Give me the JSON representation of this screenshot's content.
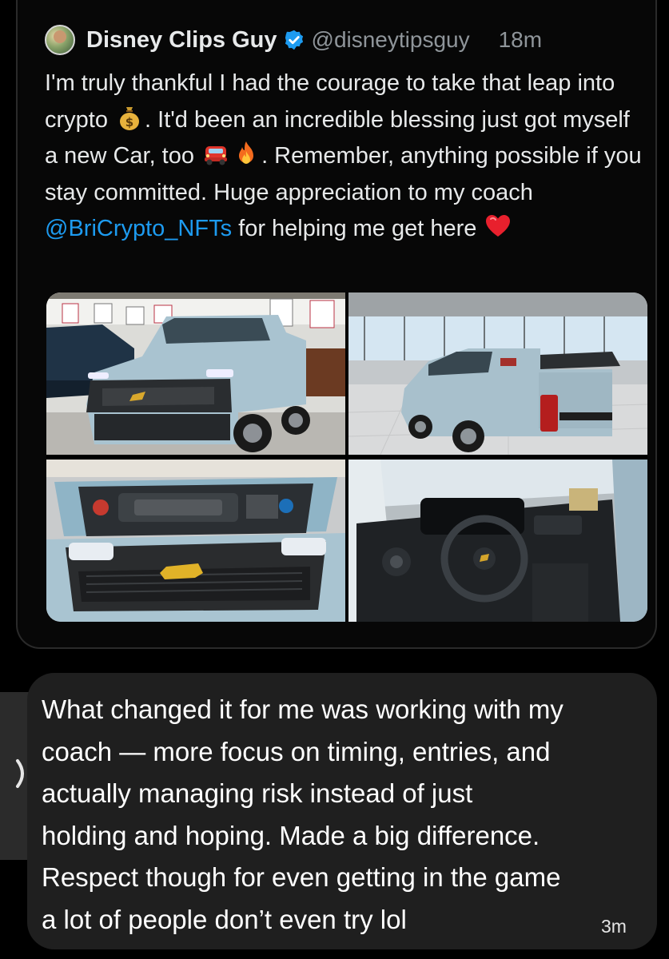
{
  "tweet": {
    "author_name": "Disney Clips Guy",
    "author_handle": "@disneytipsguy",
    "time": "18m",
    "icons": {
      "avatar": "profile-photo",
      "verified": "verified-badge-icon"
    },
    "text": {
      "part1": "I'm truly thankful I had the courage to take that leap into crypto ",
      "part2": ". It'd been an incredible blessing just got myself a new Car, too ",
      "part3": ". Remember, anything possible if you stay committed. Huge appreciation to my coach ",
      "mention": "@BriCrypto_NFTs",
      "part4": " for helping me get here "
    },
    "emojis": [
      "money-bag-emoji",
      "car-emoji",
      "fire-emoji",
      "red-heart-emoji"
    ],
    "media": [
      {
        "name": "photo-truck-front-showroom"
      },
      {
        "name": "photo-truck-rear-showroom"
      },
      {
        "name": "photo-engine-bay"
      },
      {
        "name": "photo-interior-dashboard"
      }
    ],
    "colors": {
      "mention": "#1d9bf0",
      "text": "#e7e9ea",
      "muted": "#8f959a",
      "verified": "#1d9bf0"
    }
  },
  "reply": {
    "text": "What changed it for me was working with my coach — more focus on timing, entries, and actually managing risk instead of just holding and hoping. Made a big difference. Respect though for even getting in the game a lot of people don’t even try lol",
    "lines": [
      "What changed it for me was working with my",
      "coach — more focus on timing, entries, and",
      "actually managing risk instead of just",
      "holding and hoping. Made a big difference.",
      "Respect though for even getting in the game",
      "a lot of people don’t even try lol"
    ],
    "time": "3m",
    "icons": {
      "expand": "chevron-right-icon"
    },
    "colors": {
      "bubble": "#1f1f1f"
    }
  }
}
